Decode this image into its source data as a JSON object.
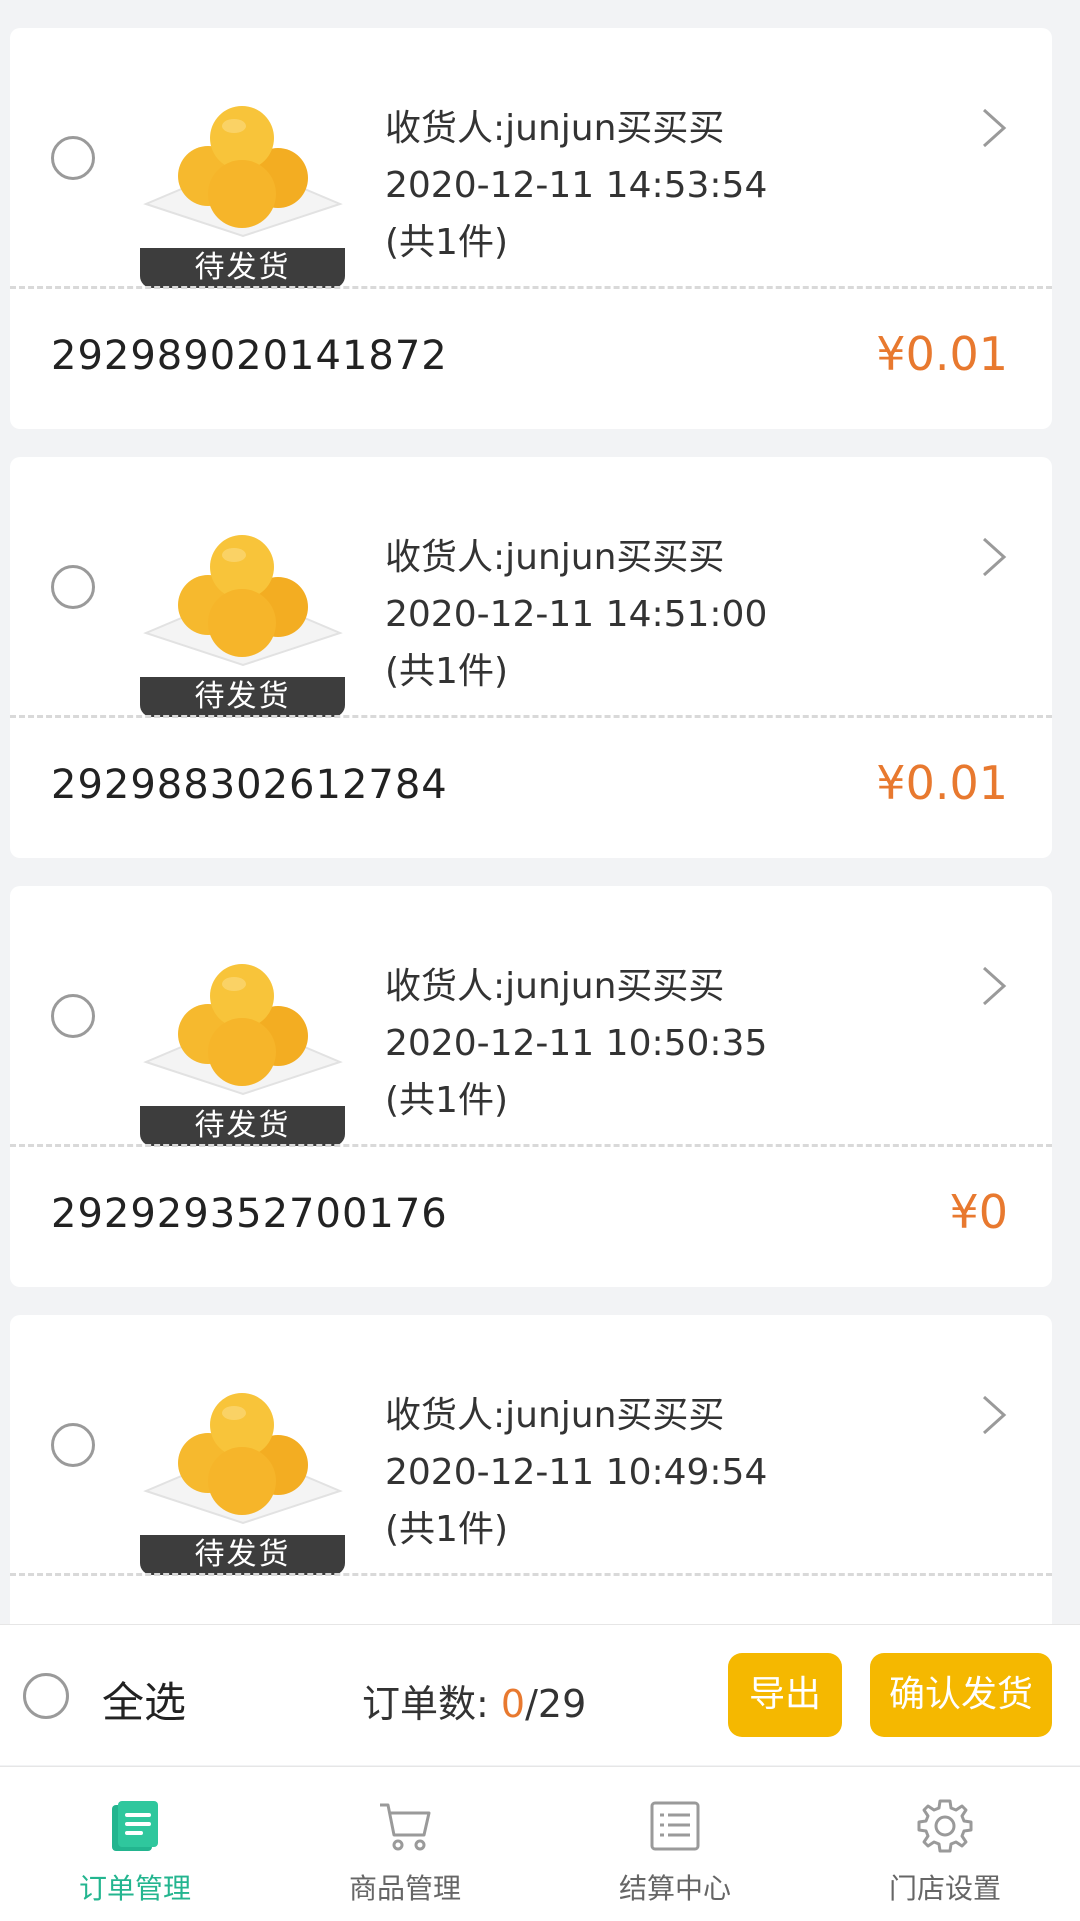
{
  "orders": [
    {
      "status": "待发货",
      "receiver": "收货人:junjun买买买",
      "datetime": "2020-12-11 14:53:54",
      "count": "(共1件)",
      "order_no": "292989020141872",
      "price": "¥0.01"
    },
    {
      "status": "待发货",
      "receiver": "收货人:junjun买买买",
      "datetime": "2020-12-11 14:51:00",
      "count": "(共1件)",
      "order_no": "292988302612784",
      "price": "¥0.01"
    },
    {
      "status": "待发货",
      "receiver": "收货人:junjun买买买",
      "datetime": "2020-12-11 10:50:35",
      "count": "(共1件)",
      "order_no": "292929352700176",
      "price": "¥0"
    },
    {
      "status": "待发货",
      "receiver": "收货人:junjun买买买",
      "datetime": "2020-12-11 10:49:54",
      "count": "(共1件)",
      "order_no": "",
      "price": ""
    }
  ],
  "action_bar": {
    "select_all": "全选",
    "order_count_label": "订单数:",
    "order_count_selected": "0",
    "order_count_total": "/29",
    "export_label": "导出",
    "confirm_label": "确认发货"
  },
  "tabs": [
    {
      "label": "订单管理",
      "icon": "order-list-icon",
      "active": true
    },
    {
      "label": "商品管理",
      "icon": "cart-icon",
      "active": false
    },
    {
      "label": "结算中心",
      "icon": "ledger-icon",
      "active": false
    },
    {
      "label": "门店设置",
      "icon": "gear-icon",
      "active": false
    }
  ],
  "colors": {
    "accent_orange": "#e8792f",
    "button_yellow": "#f5b800",
    "tab_active": "#23b58f",
    "badge_dark": "#3d3d3d"
  }
}
